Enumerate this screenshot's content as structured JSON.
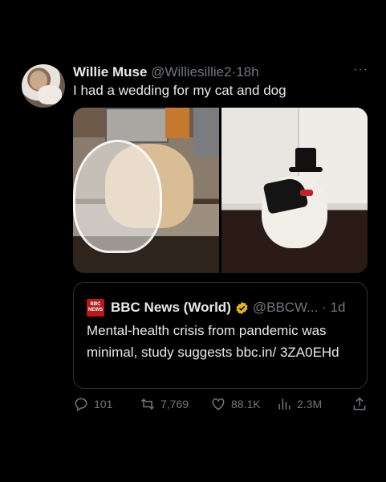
{
  "tweet": {
    "author_name": "Willie Muse",
    "author_handle": "@Williesillie2",
    "separator": "·",
    "time": "18h",
    "text": "I had a wedding for my cat and dog",
    "more_label": "···"
  },
  "media": [
    {
      "icon": "photo-dog-in-veil"
    },
    {
      "icon": "photo-cat-in-tuxedo"
    }
  ],
  "quoted": {
    "logo_lines": [
      "BBC",
      "NEWS"
    ],
    "name": "BBC News (World)",
    "handle": "@BBCW...",
    "separator": "·",
    "time": "1d",
    "text": "Mental-health crisis from pandemic was minimal, study suggests bbc.in/ 3ZA0EHd"
  },
  "actions": {
    "replies": "101",
    "retweets": "7,769",
    "likes": "88.1K",
    "views": "2.3M"
  },
  "colors": {
    "background": "#000000",
    "text": "#e7e9ea",
    "muted": "#71767b",
    "bbc_red": "#bb1919",
    "verified_gold": "#e2b719"
  }
}
